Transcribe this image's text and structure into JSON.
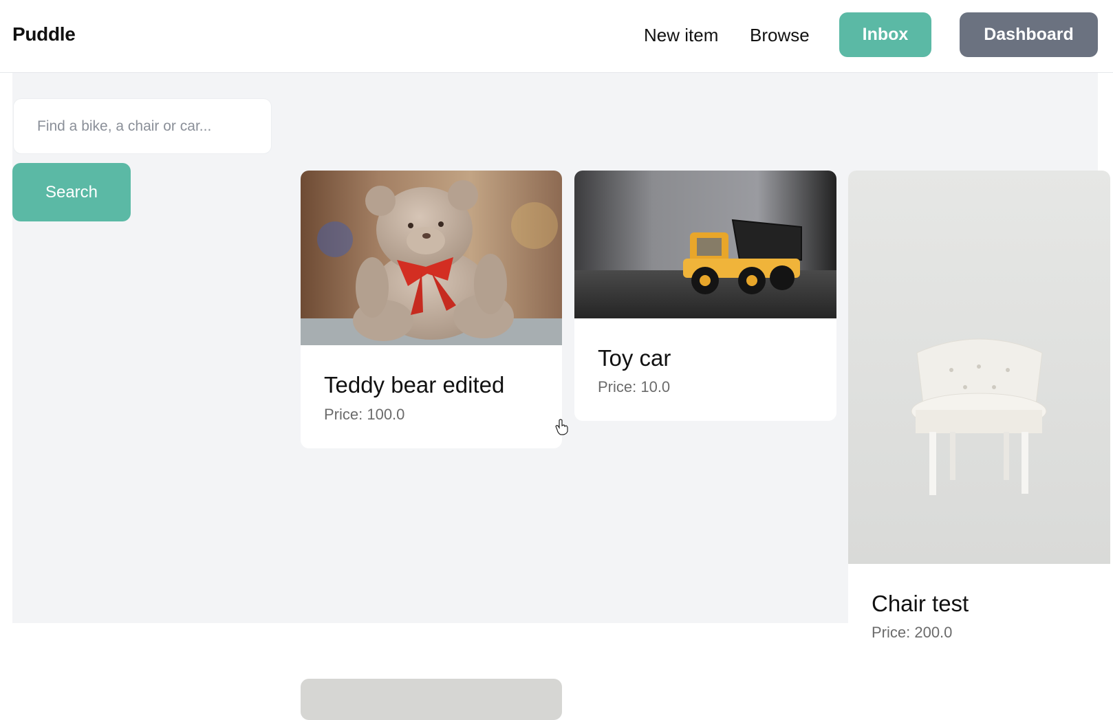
{
  "nav": {
    "brand": "Puddle",
    "new_item": "New item",
    "browse": "Browse",
    "inbox": "Inbox",
    "dashboard": "Dashboard"
  },
  "search": {
    "placeholder": "Find a bike, a chair or car...",
    "button_label": "Search"
  },
  "items": [
    {
      "title": "Teddy bear edited",
      "price": "Price: 100.0",
      "image": "teddy-bear-photo"
    },
    {
      "title": "Toy car",
      "price": "Price: 10.0",
      "image": "toy-truck-photo"
    },
    {
      "title": "Chair test",
      "price": "Price: 200.0",
      "image": "white-armchair-photo"
    }
  ],
  "colors": {
    "accent": "#5bb9a5",
    "dashboard": "#6b7280",
    "background": "#f3f4f6"
  }
}
